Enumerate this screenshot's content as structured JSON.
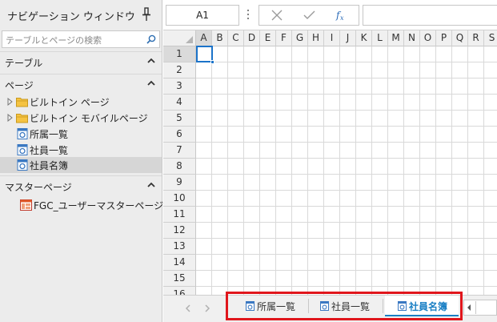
{
  "nav": {
    "title": "ナビゲーション ウィンドウ",
    "search_placeholder": "テーブルとページの検索",
    "sections": {
      "tables": "テーブル",
      "pages": "ページ",
      "master_pages": "マスターページ"
    },
    "page_items": [
      {
        "label": "ビルトイン ページ",
        "icon": "folder-icon"
      },
      {
        "label": "ビルトイン モバイルページ",
        "icon": "folder-icon"
      },
      {
        "label": "所属一覧",
        "icon": "page-icon"
      },
      {
        "label": "社員一覧",
        "icon": "page-icon"
      },
      {
        "label": "社員名簿",
        "icon": "page-icon",
        "selected": true
      }
    ],
    "master_items": [
      {
        "label": "FGC_ユーザーマスターページ",
        "icon": "master-page-icon"
      }
    ]
  },
  "formula_bar": {
    "name_box": "A1",
    "formula": ""
  },
  "grid": {
    "columns": [
      "A",
      "B",
      "C",
      "D",
      "E",
      "F",
      "G",
      "H",
      "I",
      "J",
      "K",
      "L",
      "M",
      "N",
      "O",
      "P",
      "Q",
      "R",
      "S"
    ],
    "rows": [
      "1",
      "2",
      "3",
      "4",
      "5",
      "6",
      "7",
      "8",
      "9",
      "10",
      "11",
      "12",
      "13",
      "14",
      "15",
      "16"
    ],
    "active_cell": "A1"
  },
  "sheet_tabs": [
    {
      "label": "所属一覧",
      "active": false
    },
    {
      "label": "社員一覧",
      "active": false
    },
    {
      "label": "社員名簿",
      "active": true
    }
  ],
  "colors": {
    "accent": "#1a7fc4",
    "highlight_frame": "#e0161c",
    "folder": "#f5c342"
  }
}
